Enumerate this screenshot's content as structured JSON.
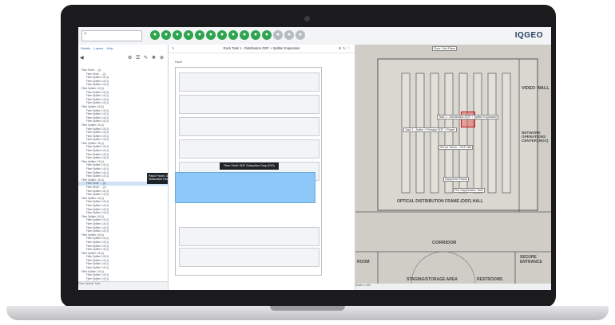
{
  "topbar": {
    "search_placeholder": "",
    "logo": "IQGEO"
  },
  "left_panel": {
    "tabs": [
      "Details",
      "Layers",
      "Help"
    ],
    "tree_rows": [
      "Fiber Shelf: ... (1)",
      "Fiber Shelf: ... (1)",
      "Fiber Splitter 1:8 (1)",
      "Fiber Splitter 1:8 (1)",
      "Fiber Splitter 1:8 (1)",
      "Fiber Splitter 1:8 (1)",
      "Fiber Splitter 1:8 (1)",
      "Fiber Splitter 1:8 (1)",
      "Fiber Splitter 1:8 (1)",
      "Fiber Splitter 1:8 (1)",
      "Fiber Splitter 1:8 (1)",
      "Fiber Splitter 1:8 (1)",
      "Fiber Splitter 1:8 (1)",
      "Fiber Splitter 1:8 (1)",
      "Fiber Splitter 1:8 (1)",
      "Fiber Splitter 1:8 (1)",
      "Fiber Splitter 1:8 (1)",
      "Fiber Splitter 1:8 (1)",
      "Fiber Splitter 1:8 (1)",
      "Fiber Splitter 1:8 (1)",
      "Fiber Splitter 1:8 (1)",
      "Fiber Splitter 1:8 (1)",
      "Fiber Splitter 1:8 (1)",
      "Fiber Splitter 1:8 (1)",
      "Fiber Splitter 1:8 (1)",
      "Fiber Splitter 1:8 (1)",
      "Fiber Splitter 1:8 (1)",
      "Fiber Splitter 1:8 (1)",
      "Fiber Splitter 1:8 (1)",
      "Fiber Splitter 1:8 (1)",
      "Fiber Splitter 1:8 (1)",
      "Fiber Shelf: ... (1)",
      "Fiber Shelf: ... (1)",
      "Fiber Splitter 1:8 (1)",
      "Fiber Splitter 1:8 (1)",
      "Fiber Splitter 1:8 (1)",
      "Fiber Splitter 1:8 (1)",
      "Fiber Splitter 1:8 (1)",
      "Fiber Splitter 1:8 (1)",
      "Fiber Splitter 1:8 (1)",
      "Fiber Splitter 1:8 (1)",
      "Fiber Splitter 1:8 (1)",
      "Fiber Splitter 1:8 (1)",
      "Fiber Splitter 1:8 (1)",
      "Fiber Splitter 1:8 (1)",
      "Fiber Splitter 1:8 (1)",
      "Fiber Splitter 1:8 (1)",
      "Fiber Splitter 1:8 (1)",
      "Fiber Splitter 1:8 (1)",
      "Fiber Splitter 1:8 (1)",
      "Fiber Splitter 1:8 (1)",
      "Fiber Splitter 1:8 (1)",
      "Fiber Splitter 1:8 (1)",
      "Fiber Splitter 1:8 (1)",
      "Fiber Splitter 1:8 (1)",
      "Fiber Splitter 1:8 (1)",
      "Fiber Splitter 1:8 (1)",
      "Fiber Splitter 1:8 (1)",
      "Fiber Splitter 1:8 (1)",
      "Fiber Splitter 1:8 (1)",
      "Fiber Splitter 1:8 (1)"
    ],
    "tooltip": "Patch Panel: ODF Subscriber Drop (ODF)",
    "footer": "Fiber Optical Tube"
  },
  "middle_panel": {
    "title": "Rack Task 1 - Distribution ODF + Splitter Expansion",
    "panel_label": "Panel",
    "bubble": "Fiber Shelf: ODF Subscriber Drop (ISO)"
  },
  "right_panel": {
    "floor_label": "Floor: Grid Plane",
    "labels": [
      "Task 1 - Distribution ODF + Splitter Expansion",
      "Task 1 - Active + Primary ODF + Power",
      "Server Room - ODF Hall",
      "Equipment Racks",
      "Fire Suppression Tank"
    ],
    "texts": [
      "VIDEO WALL",
      "NETWORK OPERATIONS CENTER (NOC)",
      "OPTICAL DISTRIBUTION FRAME (ODF) HALL",
      "CORRIDOR",
      "SECURE ENTRANCE",
      "STAGING/STORAGE AREA",
      "RESTROOMS",
      "ROOM"
    ],
    "footer": "Scale 1:100"
  },
  "colors": {
    "accent": "#2b6cb0",
    "highlight": "#8ec8f8",
    "toolbar_green": "#2ea44f"
  }
}
